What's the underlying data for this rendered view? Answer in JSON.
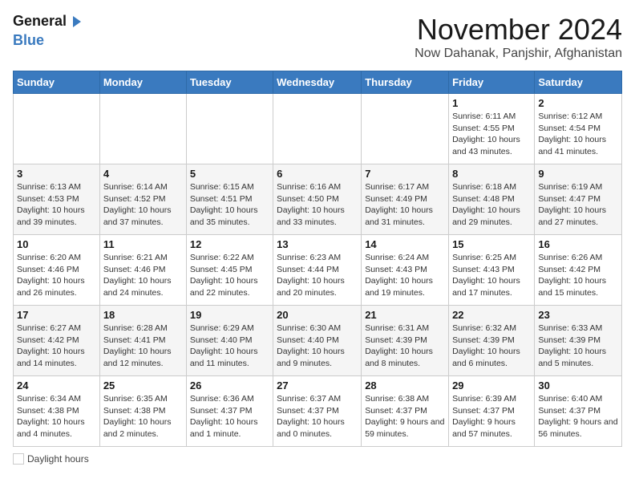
{
  "header": {
    "logo_line1": "General",
    "logo_line2": "Blue",
    "month": "November 2024",
    "location": "Now Dahanak, Panjshir, Afghanistan"
  },
  "weekdays": [
    "Sunday",
    "Monday",
    "Tuesday",
    "Wednesday",
    "Thursday",
    "Friday",
    "Saturday"
  ],
  "weeks": [
    [
      {
        "day": "",
        "info": ""
      },
      {
        "day": "",
        "info": ""
      },
      {
        "day": "",
        "info": ""
      },
      {
        "day": "",
        "info": ""
      },
      {
        "day": "",
        "info": ""
      },
      {
        "day": "1",
        "info": "Sunrise: 6:11 AM\nSunset: 4:55 PM\nDaylight: 10 hours and 43 minutes."
      },
      {
        "day": "2",
        "info": "Sunrise: 6:12 AM\nSunset: 4:54 PM\nDaylight: 10 hours and 41 minutes."
      }
    ],
    [
      {
        "day": "3",
        "info": "Sunrise: 6:13 AM\nSunset: 4:53 PM\nDaylight: 10 hours and 39 minutes."
      },
      {
        "day": "4",
        "info": "Sunrise: 6:14 AM\nSunset: 4:52 PM\nDaylight: 10 hours and 37 minutes."
      },
      {
        "day": "5",
        "info": "Sunrise: 6:15 AM\nSunset: 4:51 PM\nDaylight: 10 hours and 35 minutes."
      },
      {
        "day": "6",
        "info": "Sunrise: 6:16 AM\nSunset: 4:50 PM\nDaylight: 10 hours and 33 minutes."
      },
      {
        "day": "7",
        "info": "Sunrise: 6:17 AM\nSunset: 4:49 PM\nDaylight: 10 hours and 31 minutes."
      },
      {
        "day": "8",
        "info": "Sunrise: 6:18 AM\nSunset: 4:48 PM\nDaylight: 10 hours and 29 minutes."
      },
      {
        "day": "9",
        "info": "Sunrise: 6:19 AM\nSunset: 4:47 PM\nDaylight: 10 hours and 27 minutes."
      }
    ],
    [
      {
        "day": "10",
        "info": "Sunrise: 6:20 AM\nSunset: 4:46 PM\nDaylight: 10 hours and 26 minutes."
      },
      {
        "day": "11",
        "info": "Sunrise: 6:21 AM\nSunset: 4:46 PM\nDaylight: 10 hours and 24 minutes."
      },
      {
        "day": "12",
        "info": "Sunrise: 6:22 AM\nSunset: 4:45 PM\nDaylight: 10 hours and 22 minutes."
      },
      {
        "day": "13",
        "info": "Sunrise: 6:23 AM\nSunset: 4:44 PM\nDaylight: 10 hours and 20 minutes."
      },
      {
        "day": "14",
        "info": "Sunrise: 6:24 AM\nSunset: 4:43 PM\nDaylight: 10 hours and 19 minutes."
      },
      {
        "day": "15",
        "info": "Sunrise: 6:25 AM\nSunset: 4:43 PM\nDaylight: 10 hours and 17 minutes."
      },
      {
        "day": "16",
        "info": "Sunrise: 6:26 AM\nSunset: 4:42 PM\nDaylight: 10 hours and 15 minutes."
      }
    ],
    [
      {
        "day": "17",
        "info": "Sunrise: 6:27 AM\nSunset: 4:42 PM\nDaylight: 10 hours and 14 minutes."
      },
      {
        "day": "18",
        "info": "Sunrise: 6:28 AM\nSunset: 4:41 PM\nDaylight: 10 hours and 12 minutes."
      },
      {
        "day": "19",
        "info": "Sunrise: 6:29 AM\nSunset: 4:40 PM\nDaylight: 10 hours and 11 minutes."
      },
      {
        "day": "20",
        "info": "Sunrise: 6:30 AM\nSunset: 4:40 PM\nDaylight: 10 hours and 9 minutes."
      },
      {
        "day": "21",
        "info": "Sunrise: 6:31 AM\nSunset: 4:39 PM\nDaylight: 10 hours and 8 minutes."
      },
      {
        "day": "22",
        "info": "Sunrise: 6:32 AM\nSunset: 4:39 PM\nDaylight: 10 hours and 6 minutes."
      },
      {
        "day": "23",
        "info": "Sunrise: 6:33 AM\nSunset: 4:39 PM\nDaylight: 10 hours and 5 minutes."
      }
    ],
    [
      {
        "day": "24",
        "info": "Sunrise: 6:34 AM\nSunset: 4:38 PM\nDaylight: 10 hours and 4 minutes."
      },
      {
        "day": "25",
        "info": "Sunrise: 6:35 AM\nSunset: 4:38 PM\nDaylight: 10 hours and 2 minutes."
      },
      {
        "day": "26",
        "info": "Sunrise: 6:36 AM\nSunset: 4:37 PM\nDaylight: 10 hours and 1 minute."
      },
      {
        "day": "27",
        "info": "Sunrise: 6:37 AM\nSunset: 4:37 PM\nDaylight: 10 hours and 0 minutes."
      },
      {
        "day": "28",
        "info": "Sunrise: 6:38 AM\nSunset: 4:37 PM\nDaylight: 9 hours and 59 minutes."
      },
      {
        "day": "29",
        "info": "Sunrise: 6:39 AM\nSunset: 4:37 PM\nDaylight: 9 hours and 57 minutes."
      },
      {
        "day": "30",
        "info": "Sunrise: 6:40 AM\nSunset: 4:37 PM\nDaylight: 9 hours and 56 minutes."
      }
    ]
  ],
  "legend": {
    "label": "Daylight hours"
  }
}
